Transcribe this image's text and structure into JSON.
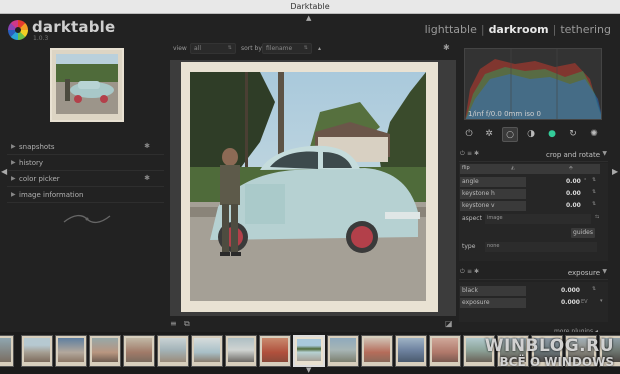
{
  "window": {
    "title": "Darktable"
  },
  "header": {
    "app_name": "darktable",
    "version": "1.0.3",
    "views": [
      "lighttable",
      "darkroom",
      "tethering"
    ],
    "separator": "|",
    "active_view": "darkroom"
  },
  "left_panel": {
    "sections": [
      {
        "label": "snapshots",
        "has_gear": true
      },
      {
        "label": "history",
        "has_gear": false
      },
      {
        "label": "color picker",
        "has_gear": true
      },
      {
        "label": "image information",
        "has_gear": false
      }
    ]
  },
  "center_toolbar": {
    "view_label": "view",
    "view_value": "all",
    "sort_label": "sort by",
    "sort_value": "filename",
    "sort_direction": "▴"
  },
  "histogram": {
    "exif_text": "1/inf f/0.0 0mm iso 0"
  },
  "module_groups": [
    "power-icon",
    "star-icon",
    "circle-icon",
    "half-circle-icon",
    "color-circle-icon",
    "swirl-icon",
    "aperture-icon"
  ],
  "crop_module": {
    "name": "crop and rotate",
    "flip_label": "flip",
    "rows": [
      {
        "label": "angle",
        "value": "0.00",
        "unit": "°"
      },
      {
        "label": "keystone h",
        "value": "0.00",
        "unit": ""
      },
      {
        "label": "keystone v",
        "value": "0.00",
        "unit": ""
      }
    ],
    "aspect_label": "aspect",
    "aspect_value": "image",
    "guides_button": "guides",
    "type_label": "type",
    "type_value": "none"
  },
  "exposure_module": {
    "name": "exposure",
    "rows": [
      {
        "label": "black",
        "value": "0.000",
        "unit": ""
      },
      {
        "label": "exposure",
        "value": "0.000",
        "unit": "EV"
      }
    ]
  },
  "more_plugins": "more plugins",
  "watermark": {
    "line1": "WINBLOG.RU",
    "line2": "ВСЁ О WINDOWS"
  },
  "colors": {
    "background": "#222222",
    "titlebar": "#e8e8e8",
    "active_view": "#e8e8e8",
    "histogram_red": "#c0392b",
    "histogram_green": "#27ae60",
    "histogram_blue": "#2e6fd6"
  }
}
